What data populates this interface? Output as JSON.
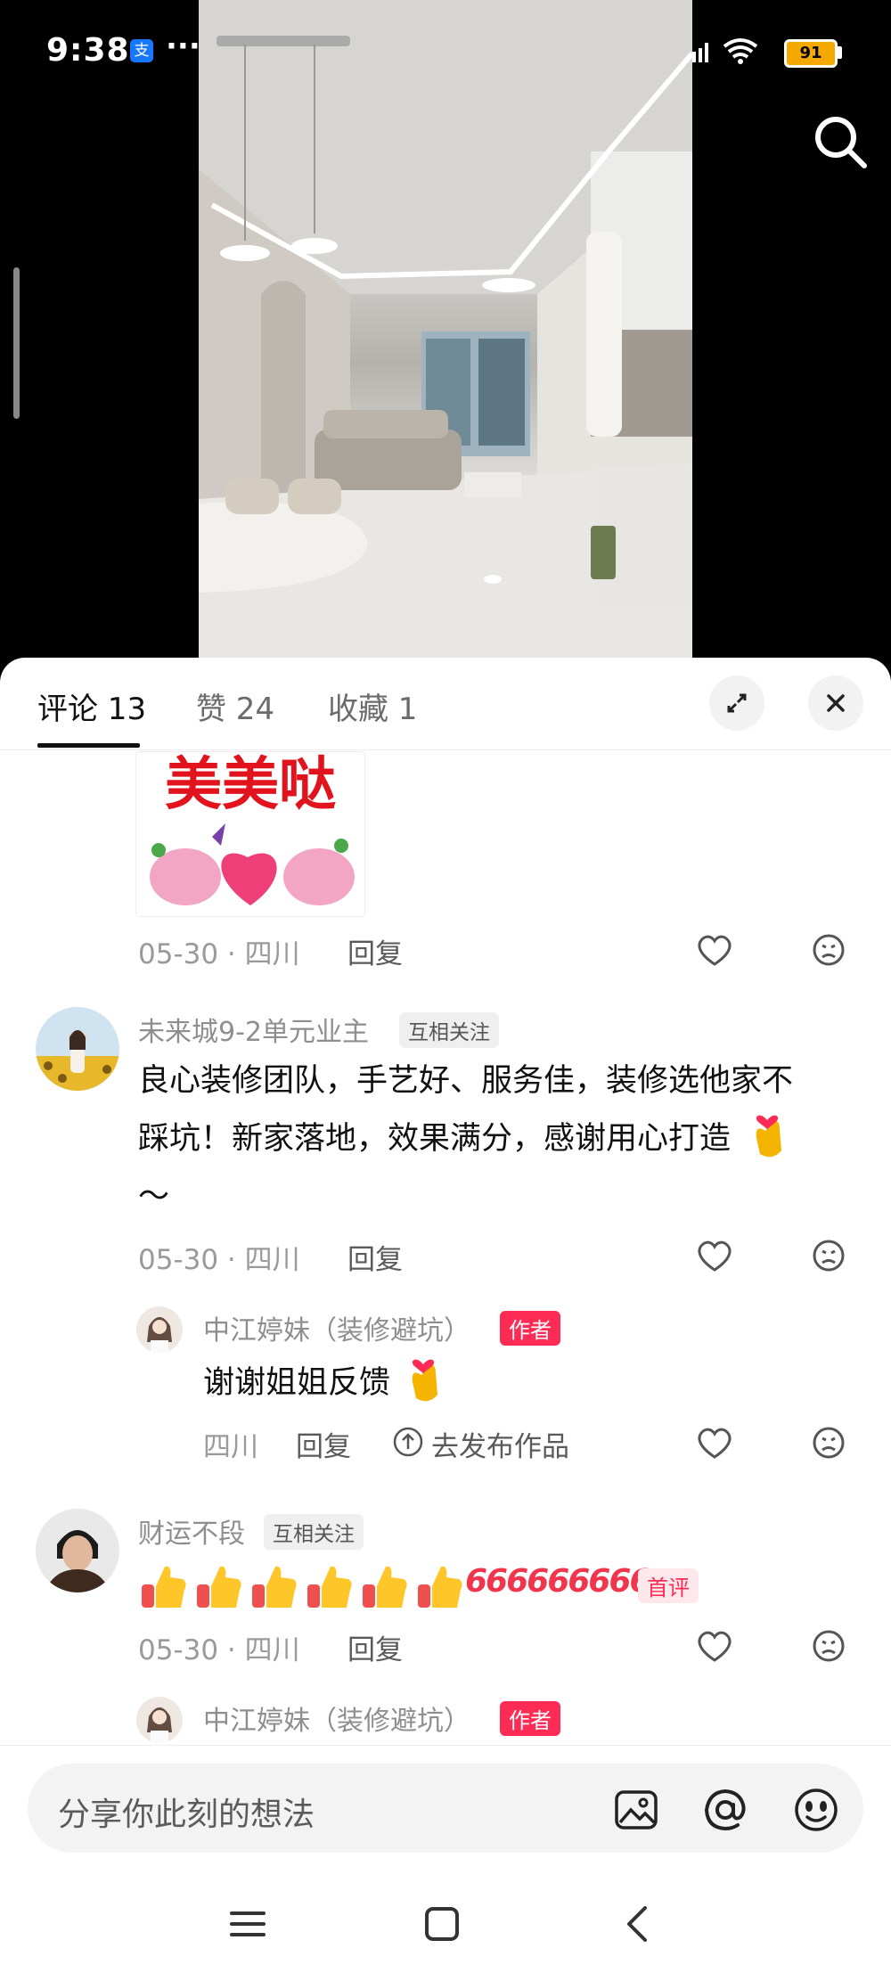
{
  "status_bar": {
    "time": "9:38",
    "app_badge": "支",
    "more": "···",
    "signal_1": "5G",
    "signal_2": "5G",
    "battery": "91"
  },
  "sheet": {
    "tabs": [
      {
        "label": "评论 13"
      },
      {
        "label": "赞 24"
      },
      {
        "label": "收藏 1"
      }
    ]
  },
  "comments": {
    "sticker": {
      "text": "美美哒"
    },
    "c0": {
      "date": "05-30 · 四川",
      "reply": "回复"
    },
    "c1": {
      "username": "未来城9-2单元业主",
      "tag": "互相关注",
      "text_line1": "良心装修团队，手艺好、服务佳，装修选他家不",
      "text_line2": "踩坑！新家落地，效果满分，感谢用心打造",
      "text_line3": "～",
      "date": "05-30 · 四川",
      "reply": "回复",
      "sub": {
        "username": "中江婷妹（装修避坑）",
        "tag": "作者",
        "text": "谢谢姐姐反馈",
        "location": "四川",
        "reply": "回复",
        "publish": "去发布作品"
      }
    },
    "c2": {
      "username": "财运不段",
      "tag": "互相关注",
      "text": "666666666",
      "first_tag": "首评",
      "date": "05-30 · 四川",
      "reply": "回复",
      "sub": {
        "username": "中江婷妹（装修避坑）",
        "tag": "作者"
      }
    }
  },
  "input": {
    "placeholder": "分享你此刻的想法"
  },
  "icons": [
    "search-icon",
    "expand-icon",
    "close-icon",
    "heart-icon",
    "dislike-icon",
    "upload-icon",
    "image-icon",
    "at-icon",
    "emoji-icon",
    "menu-icon",
    "home-icon",
    "back-icon"
  ],
  "colors": {
    "accent": "#fe2c55",
    "text": "#111111",
    "muted": "#9a9a9a"
  }
}
